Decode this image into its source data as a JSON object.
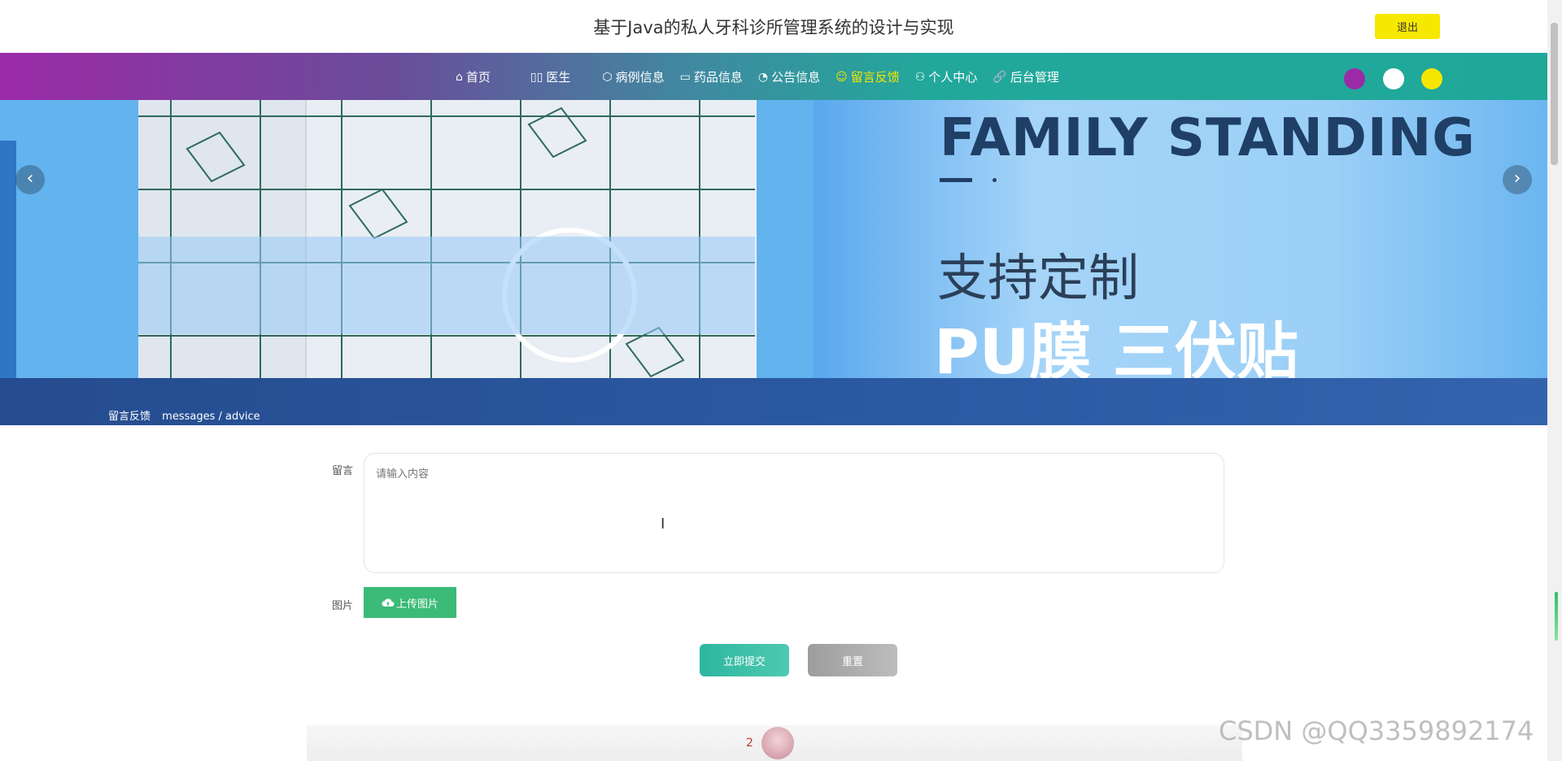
{
  "header": {
    "title": "基于Java的私人牙科诊所管理系统的设计与实现",
    "logout_label": "退出"
  },
  "nav": {
    "items": [
      {
        "label": "首页",
        "icon": "home-icon",
        "glyph": "⌂"
      },
      {
        "label": "医生",
        "icon": "book-icon",
        "glyph": "▯▯"
      },
      {
        "label": "病例信息",
        "icon": "cube-icon",
        "glyph": "⬡"
      },
      {
        "label": "药品信息",
        "icon": "document-icon",
        "glyph": "▭"
      },
      {
        "label": "公告信息",
        "icon": "dashboard-icon",
        "glyph": "◔"
      },
      {
        "label": "留言反馈",
        "icon": "smile-icon",
        "glyph": "☺",
        "active": true
      },
      {
        "label": "个人中心",
        "icon": "user-icon",
        "glyph": "⚇"
      },
      {
        "label": "后台管理",
        "icon": "link-icon",
        "glyph": "🔗"
      }
    ],
    "active_color": "#f5e600"
  },
  "theme_dots": [
    {
      "name": "purple",
      "color": "#9b2aa7"
    },
    {
      "name": "white",
      "color": "#ffffff"
    },
    {
      "name": "yellow",
      "color": "#f5e600"
    }
  ],
  "banner": {
    "headline_en": "FAMILY STANDING",
    "headline_cn": "支持定制",
    "subline_cn": "PU膜 三伏贴",
    "prev_glyph": "‹",
    "next_glyph": "›"
  },
  "breadcrumb": {
    "title": "留言反馈",
    "path": "messages / advice"
  },
  "form": {
    "message_label": "留言",
    "message_placeholder": "请输入内容",
    "image_label": "图片",
    "upload_label": "上传图片",
    "submit_label": "立即提交",
    "reset_label": "重置"
  },
  "comments": {
    "count": "2"
  },
  "watermark": "CSDN @QQ3359892174",
  "colors": {
    "nav_start": "#9b2aa7",
    "nav_end": "#1fa89a",
    "logout_bg": "#f7e800",
    "upload_bg": "#3cba77",
    "submit_bg": "#2db7a0",
    "breadcrumb_bg": "#2b5aa3"
  }
}
